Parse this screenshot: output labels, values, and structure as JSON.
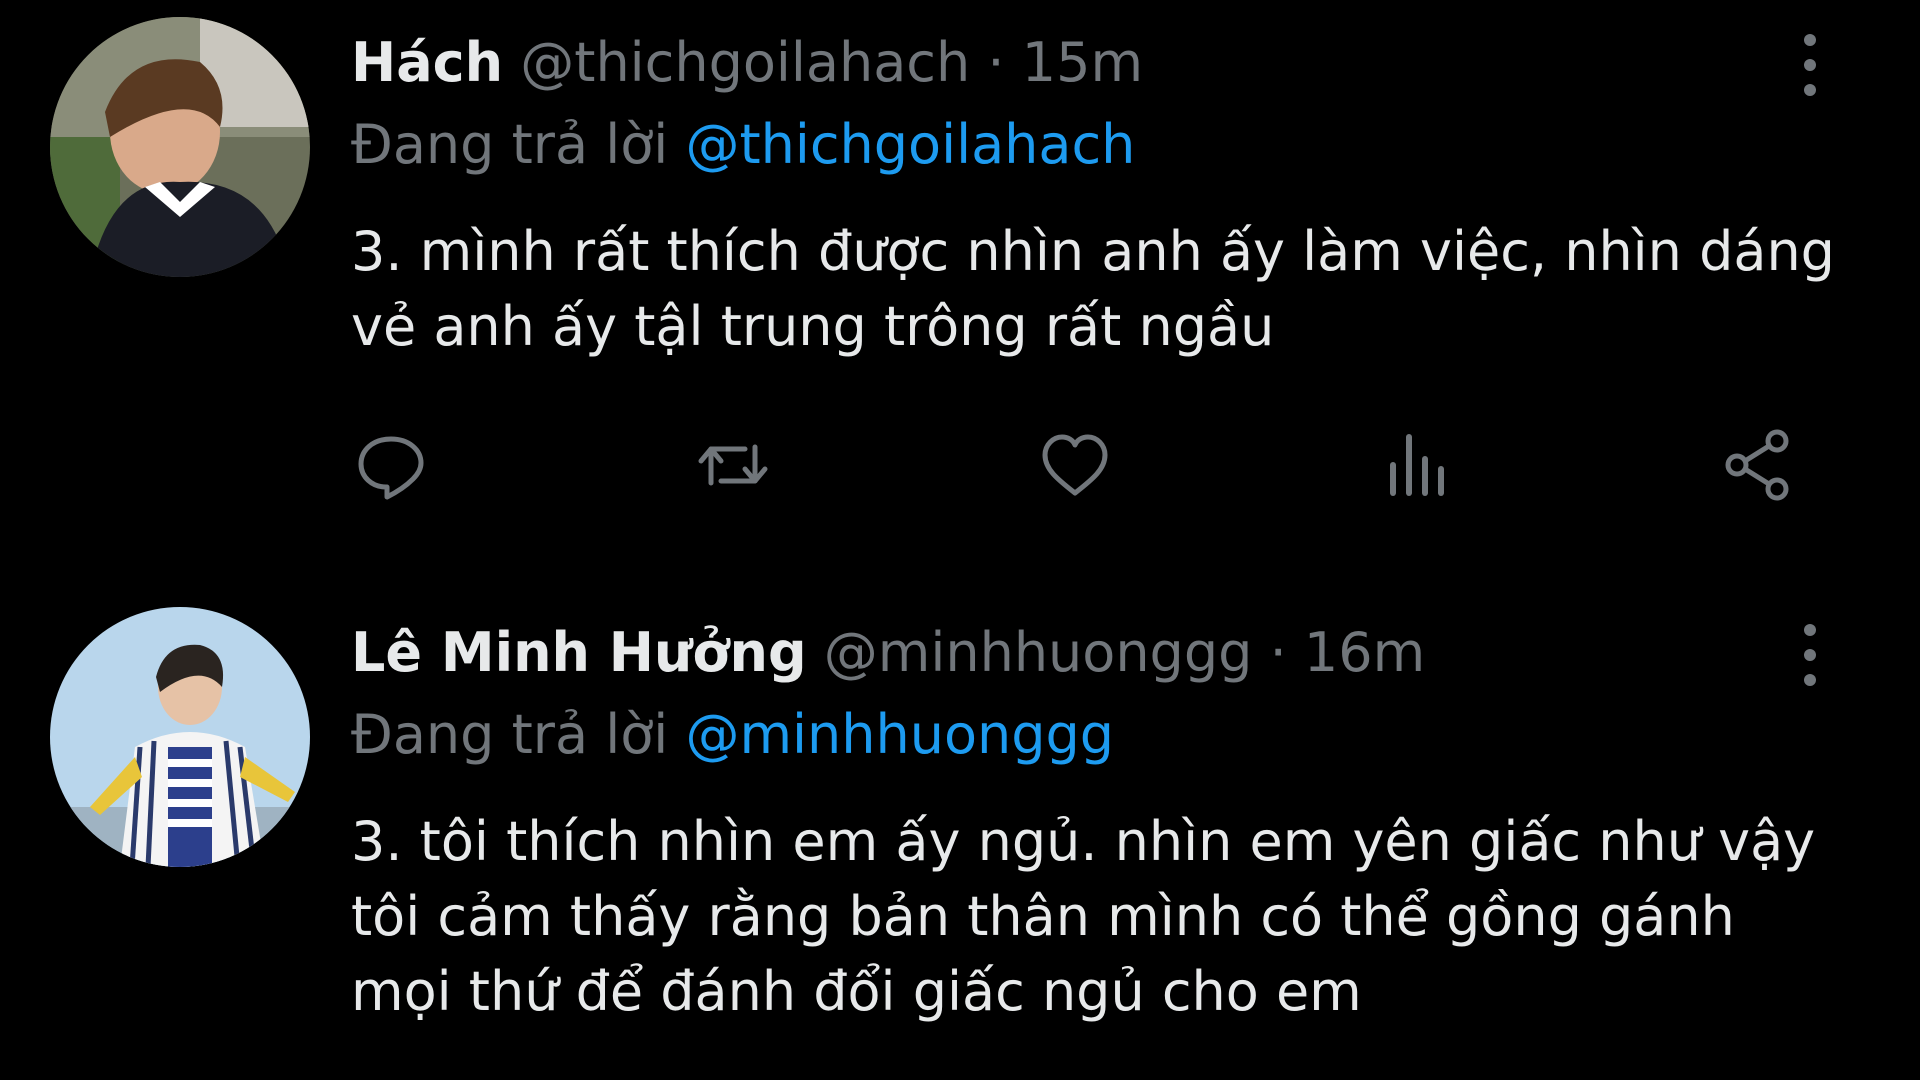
{
  "tweets": [
    {
      "display_name": "Hách",
      "handle": "@thichgoilahach",
      "separator": "·",
      "time": "15m",
      "reply_prefix": "Đang trả lời",
      "reply_to": "@thichgoilahach",
      "text": "3. mình rất thích được nhìn anh ấy làm việc, nhìn dáng\nvẻ anh ấy tậl trung trông rất ngầu",
      "actions": [
        "reply-icon",
        "retweet-icon",
        "heart-icon",
        "views-icon",
        "share-icon"
      ]
    },
    {
      "display_name": "Lê Minh Hưởng",
      "handle": "@minhhuonggg",
      "separator": "·",
      "time": "16m",
      "reply_prefix": "Đang trả lời",
      "reply_to": "@minhhuonggg",
      "text": "3. tôi thích nhìn em ấy ngủ. nhìn em yên giấc như vậy\ntôi cảm thấy rằng bản thân mình có thể gồng gánh\nmọi thứ để đánh đổi giấc ngủ cho em"
    }
  ],
  "colors": {
    "background": "#000000",
    "primary_text": "#e7e9ea",
    "secondary_text": "#71767b",
    "accent": "#1d9bf0"
  }
}
